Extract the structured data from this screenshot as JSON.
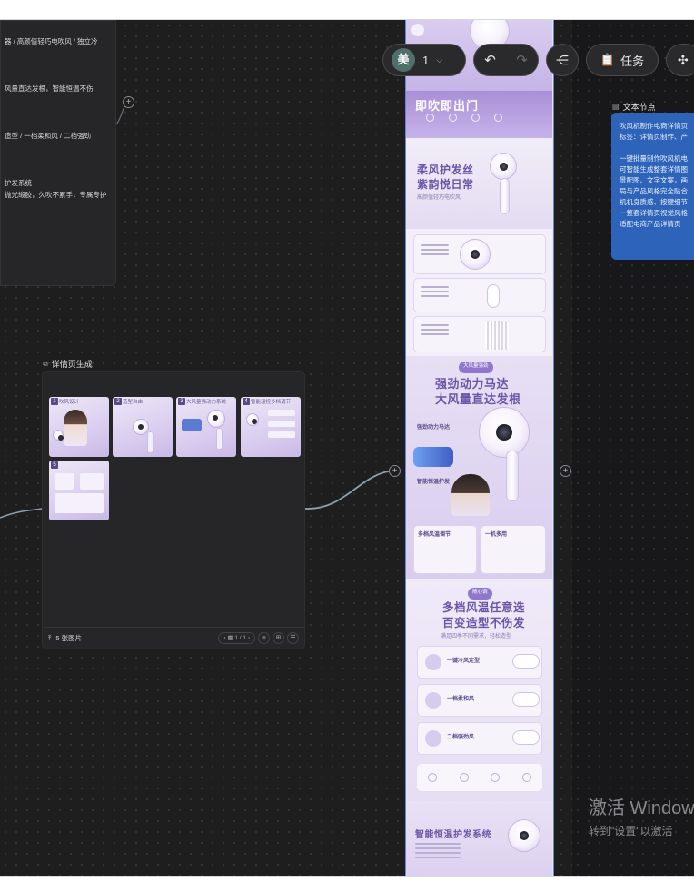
{
  "left_text_card": {
    "lines": [
      "器 / 高颜值轻巧电吹风 / 独立冷",
      "",
      "",
      "",
      "风量直达发根，智能恒温不伤",
      "",
      "",
      "",
      "造型 / 一档柔和风 / 二档强劲",
      "",
      "",
      "",
      "护发系统",
      "抛光缎胶，久吹不累手，专属专护"
    ]
  },
  "detail_node": {
    "title": "详情页生成",
    "thumbnails": [
      {
        "num": "1",
        "caption": "吹风设计"
      },
      {
        "num": "2",
        "caption": "造型自由"
      },
      {
        "num": "3",
        "caption": "大风量强动力系统"
      },
      {
        "num": "4",
        "caption": "智能温控多档调节"
      },
      {
        "num": "5",
        "caption": ""
      }
    ],
    "footer": {
      "count_label": "5 张图片",
      "page_label": "1 / 1"
    }
  },
  "product_strip": {
    "banner_title": "即吹即出门",
    "s2_line1": "柔风护发丝",
    "s2_line2": "紫韵悦日常",
    "s2_sub": "高颜值轻巧电吹风",
    "s4_tag": "大风量强劲",
    "s4_line1": "强劲动力马达",
    "s4_line2": "大风量直达发根",
    "s4_f1": "强劲动力马达",
    "s4_f2": "智能恒温护发",
    "s4_f3": "多档风温调节",
    "s4_f4": "一机多用",
    "s5_tag": "随心调",
    "s5_line1": "多档风温任意选",
    "s5_line2": "百变造型不伤发",
    "s5_sub": "满足四季不同需求，轻松造型",
    "s5_o1": "一键冷风定型",
    "s5_o2": "一档柔和风",
    "s5_o3": "二档强劲风",
    "s6_line1": "智能恒温护发系统"
  },
  "toolbar": {
    "avatar_char": "美",
    "user_count": "1",
    "task_label": "任务"
  },
  "text_node": {
    "title": "文本节点",
    "lines": [
      "吹风机制作电商详情页",
      "标签：详情页制作、产",
      "",
      "一键批量制作吹风机电",
      "可智能生成整套详情图",
      "景配图、文字文案，画",
      "局与产品风格完全贴合",
      "机机身质感、按键细节",
      "一整套详情页视觉风格",
      "适配电商产品详情页"
    ]
  },
  "watermark": {
    "line1": "激活 Windows",
    "line2": "转到\"设置\"以激活"
  },
  "colors": {
    "canvas": "#1e1e1f",
    "accent_blue": "#2d63b8",
    "lavender": "#e9e4f4",
    "brand_purple": "#6a55a6"
  }
}
